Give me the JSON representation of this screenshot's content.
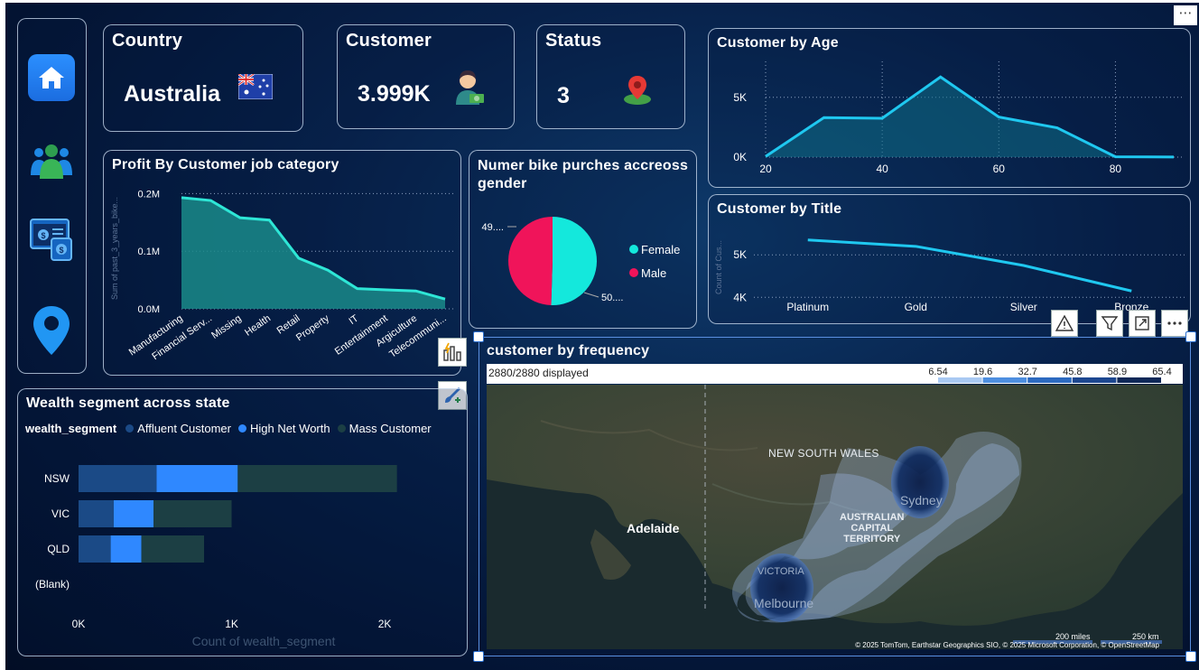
{
  "kpis": {
    "country": {
      "title": "Country",
      "value": "Australia",
      "icon": "australia-flag-icon"
    },
    "customer": {
      "title": "Customer",
      "value": "3.999K",
      "icon": "customer-avatar-icon"
    },
    "status": {
      "title": "Status",
      "value": "3",
      "icon": "map-pin-icon"
    }
  },
  "nav": {
    "items": [
      {
        "icon": "home-icon"
      },
      {
        "icon": "users-icon"
      },
      {
        "icon": "finance-screen-icon"
      },
      {
        "icon": "location-pin-icon"
      }
    ]
  },
  "profit_chart": {
    "title": "Profit By Customer job category",
    "ylabel": "Sum of past_3_years_bike...",
    "ytick_labels": [
      "0.2M",
      "0.1M",
      "0.0M"
    ],
    "chart_data": {
      "type": "area",
      "categories": [
        "Manufacturing",
        "Financial Serv...",
        "Missing",
        "Health",
        "Retail",
        "Property",
        "IT",
        "Entertainment",
        "Argiculture",
        "Telecommuni..."
      ],
      "values": [
        193000,
        188000,
        158000,
        154000,
        88000,
        67000,
        35000,
        33000,
        31000,
        17000
      ],
      "ylim": [
        0,
        210000
      ],
      "color": "#2ee6d6"
    }
  },
  "gender_chart": {
    "title": "Numer bike purches accreoss gender",
    "chart_data": {
      "type": "pie",
      "labels": [
        "Female",
        "Male"
      ],
      "values": [
        50.5,
        49.5
      ],
      "data_labels": [
        "50....",
        "49...."
      ],
      "colors": [
        "#14e8dc",
        "#f0145a"
      ]
    }
  },
  "age_chart": {
    "title": "Customer by Age",
    "ytick_labels": [
      "5K",
      "0K"
    ],
    "xtick_labels": [
      "20",
      "40",
      "60",
      "80"
    ],
    "chart_data": {
      "type": "area",
      "x": [
        20,
        30,
        40,
        50,
        60,
        70,
        80,
        90
      ],
      "values": [
        60,
        3300,
        3250,
        6700,
        3350,
        2450,
        30,
        10
      ],
      "xlim": [
        20,
        90
      ],
      "ylim": [
        0,
        8000
      ],
      "color": "#1fc8f0"
    }
  },
  "title_chart": {
    "title": "Customer by Title",
    "ylabel": "Count of Cus...",
    "ytick_labels": [
      "5K",
      "4K"
    ],
    "chart_data": {
      "type": "line",
      "categories": [
        "Platinum",
        "Gold",
        "Silver",
        "Bronze"
      ],
      "values": [
        5350,
        5200,
        4750,
        4150
      ],
      "ylim": [
        3900,
        5600
      ],
      "color": "#1fc8f0"
    }
  },
  "wealth_chart": {
    "title": "Wealth segment across state",
    "legend_title": "wealth_segment",
    "xlabel": "Count of wealth_segment",
    "xtick_labels": [
      "0K",
      "1K",
      "2K"
    ],
    "chart_data": {
      "type": "bar",
      "orientation": "horizontal",
      "stacked": true,
      "categories": [
        "NSW",
        "VIC",
        "QLD",
        "(Blank)"
      ],
      "series": [
        {
          "name": "Affluent Customer",
          "color": "#1b4a86",
          "values": [
            510,
            230,
            210,
            0
          ]
        },
        {
          "name": "High Net Worth",
          "color": "#2f88ff",
          "values": [
            530,
            260,
            200,
            0
          ]
        },
        {
          "name": "Mass Customer",
          "color": "#1c3f44",
          "values": [
            1040,
            510,
            410,
            0
          ]
        }
      ],
      "xlim": [
        0,
        2200
      ]
    }
  },
  "map": {
    "title": "customer by frequency",
    "displayed": "2880/2880 displayed",
    "scale_ticks": [
      "6.54",
      "19.6",
      "32.7",
      "45.8",
      "58.9",
      "65.4"
    ],
    "labels": {
      "nsw": "NEW SOUTH WALES",
      "adelaide": "Adelaide",
      "act": "AUSTRALIAN\nCAPITAL\nTERRITORY",
      "sydney": "Sydney",
      "victoria": "VICTORIA",
      "melbourne": "Melbourne"
    },
    "scale_bar": {
      "miles": "200 miles",
      "km": "250 km"
    },
    "attribution": "© 2025 TomTom, Earthstar Geographics SIO, © 2025 Microsoft Corporation, © OpenStreetMap"
  },
  "toolbar": {
    "icons": [
      "warning-icon",
      "filter-icon",
      "focus-mode-icon",
      "more-options-icon"
    ]
  },
  "side_buttons": [
    "quick-insights-icon",
    "format-brush-icon"
  ]
}
